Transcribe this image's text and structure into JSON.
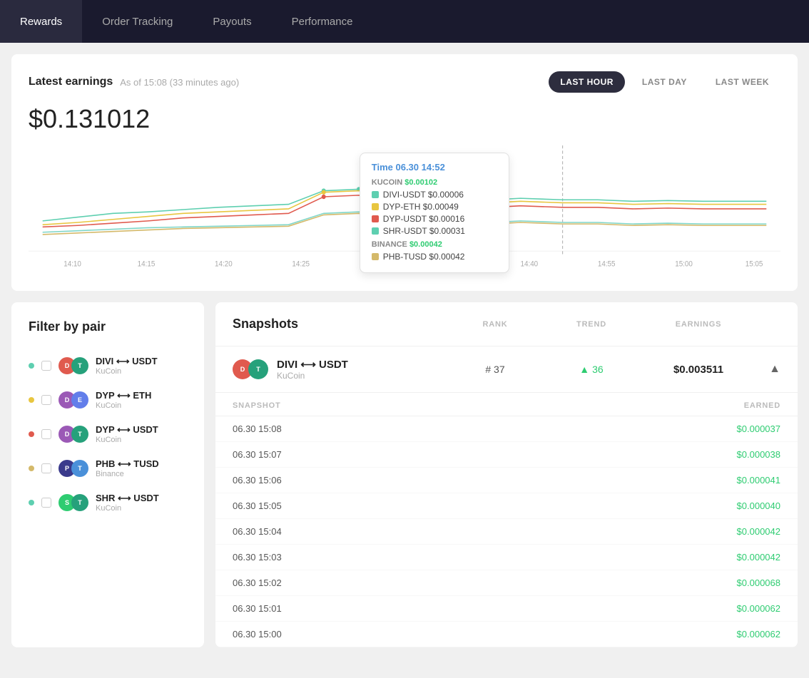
{
  "nav": {
    "tabs": [
      {
        "id": "rewards",
        "label": "Rewards",
        "active": true
      },
      {
        "id": "order-tracking",
        "label": "Order Tracking",
        "active": false
      },
      {
        "id": "payouts",
        "label": "Payouts",
        "active": false
      },
      {
        "id": "performance",
        "label": "Performance",
        "active": false
      }
    ]
  },
  "earnings_card": {
    "title": "Latest earnings",
    "subtitle": "As of 15:08 (33 minutes ago)",
    "amount": "$0.131012",
    "time_buttons": [
      {
        "label": "LAST HOUR",
        "active": true
      },
      {
        "label": "LAST DAY",
        "active": false
      },
      {
        "label": "LAST WEEK",
        "active": false
      }
    ]
  },
  "tooltip": {
    "time_label": "Time",
    "time_value": "06.30 14:52",
    "kucoin_label": "KUCOIN",
    "kucoin_value": "$0.00102",
    "kucoin_pairs": [
      {
        "color": "#5ecfb0",
        "label": "DIVI-USDT $0.00006"
      },
      {
        "color": "#e8c640",
        "label": "DYP-ETH $0.00049"
      },
      {
        "color": "#e05a4e",
        "label": "DYP-USDT $0.00016"
      },
      {
        "color": "#5ecfb0",
        "label": "SHR-USDT $0.00031"
      }
    ],
    "binance_label": "BINANCE",
    "binance_value": "$0.00042",
    "binance_pairs": [
      {
        "color": "#d4b96a",
        "label": "PHB-TUSD $0.00042"
      }
    ]
  },
  "filter": {
    "title": "Filter by pair",
    "pairs": [
      {
        "dot_color": "#5ecfb0",
        "name": "DIVI ⟷ USDT",
        "exchange": "KuCoin",
        "icon1_bg": "#e05a4e",
        "icon1_text": "D",
        "icon2_bg": "#26a17b",
        "icon2_text": "T"
      },
      {
        "dot_color": "#e8c640",
        "name": "DYP ⟷ ETH",
        "exchange": "KuCoin",
        "icon1_bg": "#9b59b6",
        "icon1_text": "D",
        "icon2_bg": "#627eea",
        "icon2_text": "E"
      },
      {
        "dot_color": "#e05a4e",
        "name": "DYP ⟷ USDT",
        "exchange": "KuCoin",
        "icon1_bg": "#9b59b6",
        "icon1_text": "D",
        "icon2_bg": "#26a17b",
        "icon2_text": "T"
      },
      {
        "dot_color": "#d4b96a",
        "name": "PHB ⟷ TUSD",
        "exchange": "Binance",
        "icon1_bg": "#3a3a8c",
        "icon1_text": "P",
        "icon2_bg": "#4a90d9",
        "icon2_text": "T"
      },
      {
        "dot_color": "#5ecfb0",
        "name": "SHR ⟷ USDT",
        "exchange": "KuCoin",
        "icon1_bg": "#2ecc71",
        "icon1_text": "S",
        "icon2_bg": "#26a17b",
        "icon2_text": "T"
      }
    ]
  },
  "snapshots": {
    "title": "Snapshots",
    "col_rank": "RANK",
    "col_trend": "TREND",
    "col_earnings": "EARNINGS",
    "col_snapshot": "SNAPSHOT",
    "col_earned": "EARNED",
    "active_pair": {
      "name": "DIVI ⟷ USDT",
      "exchange": "KuCoin",
      "rank": "# 37",
      "trend": "36",
      "earnings": "$0.003511"
    },
    "rows": [
      {
        "date": "06.30 15:08",
        "earned": "$0.000037"
      },
      {
        "date": "06.30 15:07",
        "earned": "$0.000038"
      },
      {
        "date": "06.30 15:06",
        "earned": "$0.000041"
      },
      {
        "date": "06.30 15:05",
        "earned": "$0.000040"
      },
      {
        "date": "06.30 15:04",
        "earned": "$0.000042"
      },
      {
        "date": "06.30 15:03",
        "earned": "$0.000042"
      },
      {
        "date": "06.30 15:02",
        "earned": "$0.000068"
      },
      {
        "date": "06.30 15:01",
        "earned": "$0.000062"
      },
      {
        "date": "06.30 15:00",
        "earned": "$0.000062"
      }
    ]
  }
}
